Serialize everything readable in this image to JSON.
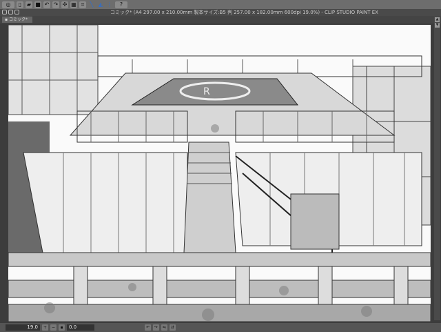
{
  "toolbar": {
    "items": [
      {
        "name": "studio-logo-icon",
        "glyph": "◎"
      },
      {
        "name": "new-file-icon",
        "glyph": "▯"
      },
      {
        "name": "open-file-icon",
        "glyph": "▰"
      },
      {
        "name": "save-icon",
        "glyph": "■"
      },
      {
        "name": "undo-icon",
        "glyph": "↶"
      },
      {
        "name": "redo-icon",
        "glyph": "↷"
      },
      {
        "name": "clear-icon",
        "glyph": "✣"
      },
      {
        "name": "fill-icon",
        "glyph": "▦"
      },
      {
        "name": "transform-icon",
        "glyph": "⌗"
      },
      {
        "name": "snap-ruler-icon",
        "glyph": "╲"
      },
      {
        "name": "snap-special-ruler-icon",
        "glyph": "◭"
      },
      {
        "name": "snap-grid-icon",
        "glyph": "⋮"
      },
      {
        "name": "help-icon",
        "glyph": "?"
      }
    ]
  },
  "window": {
    "title": "コミック* (A4 297.00 x 210.00mm 製本サイズ:B5 判 257.00 x 182.00mm 600dpi 19.0%)  - CLIP STUDIO PAINT EX"
  },
  "tab": {
    "label": "コミック*"
  },
  "status": {
    "zoom": "19.0",
    "rotation": "0.0"
  },
  "colors": {
    "page": "#ffffff",
    "ink": "#333333",
    "background": "#3c3c3c"
  }
}
